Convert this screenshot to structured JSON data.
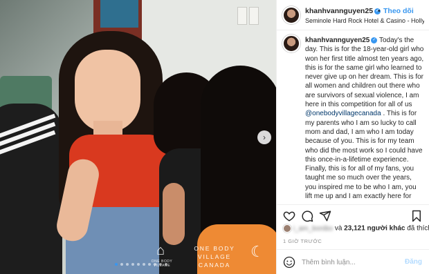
{
  "header": {
    "username": "khanhvannguyen25",
    "separator": "•",
    "follow_label": "Theo dõi",
    "location": "Seminole Hard Rock Hotel & Casino - Holly..."
  },
  "caption": {
    "username": "khanhvannguyen25",
    "text_part1": " Today's the day. This is for the 18-year-old girl who won her first title almost ten years ago, this is for the same girl who learned to never give up on her dream. This is for all women and children out there who are survivors of sexual violence, I am here in this competition for all of us ",
    "mention": "@onebodyvillagecanada",
    "text_part2": " . This is for my parents who I am so lucky to call mom and dad, I am who I am today because of you. This is for my team who did the most work so I could have this once-in-a-lifetime experience. Finally, this is for all of my fans, you taught me so much over the years, you inspired me to be who I am, you lift me up and I am exactly here for you."
  },
  "photo": {
    "watermark_line1": "ONE BODY VILLAGE",
    "watermark_line2": "CANADA",
    "watermark_sub": "ONE BODY VILLAGE",
    "next_arrow": "›",
    "carousel_dots": 10,
    "carousel_active_index": 0
  },
  "actions": {
    "like_icon": "heart-icon",
    "comment_icon": "comment-icon",
    "share_icon": "paper-plane-icon",
    "save_icon": "bookmark-icon"
  },
  "likes": {
    "blurred_name": "i_am_bonibo",
    "connector": " và ",
    "count": "23,121 người khác",
    "suffix": " đã thích"
  },
  "timestamp": "1 GIỜ TRƯỚC",
  "comment": {
    "placeholder": "Thêm bình luận...",
    "post_label": "Đăng"
  },
  "colors": {
    "accent": "#3897f0",
    "post_disabled": "#b3dbff",
    "muted": "#8e8e8e",
    "text": "#262626",
    "mention": "#00376b"
  }
}
